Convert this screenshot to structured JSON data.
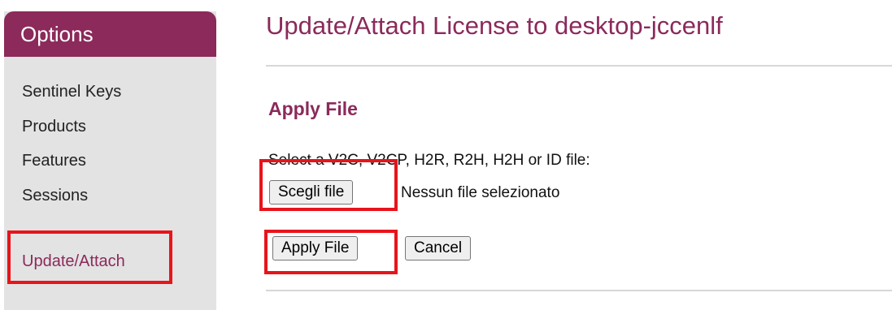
{
  "sidebar": {
    "header": "Options",
    "items": [
      {
        "label": "Sentinel Keys"
      },
      {
        "label": "Products"
      },
      {
        "label": "Features"
      },
      {
        "label": "Sessions"
      },
      {
        "label": "Update/Attach",
        "active": true
      }
    ]
  },
  "main": {
    "title": "Update/Attach License to desktop-jccenlf",
    "section_heading": "Apply File",
    "instruction": "Select a V2C, V2CP, H2R, R2H, H2H or ID file:",
    "file_input": {
      "button_label": "Scegli file",
      "status": "Nessun file selezionato"
    },
    "actions": {
      "apply_label": "Apply File",
      "cancel_label": "Cancel"
    }
  },
  "colors": {
    "accent": "#8b2a5b",
    "sidebar_bg": "#e3e3e3",
    "highlight": "#e8141b"
  }
}
